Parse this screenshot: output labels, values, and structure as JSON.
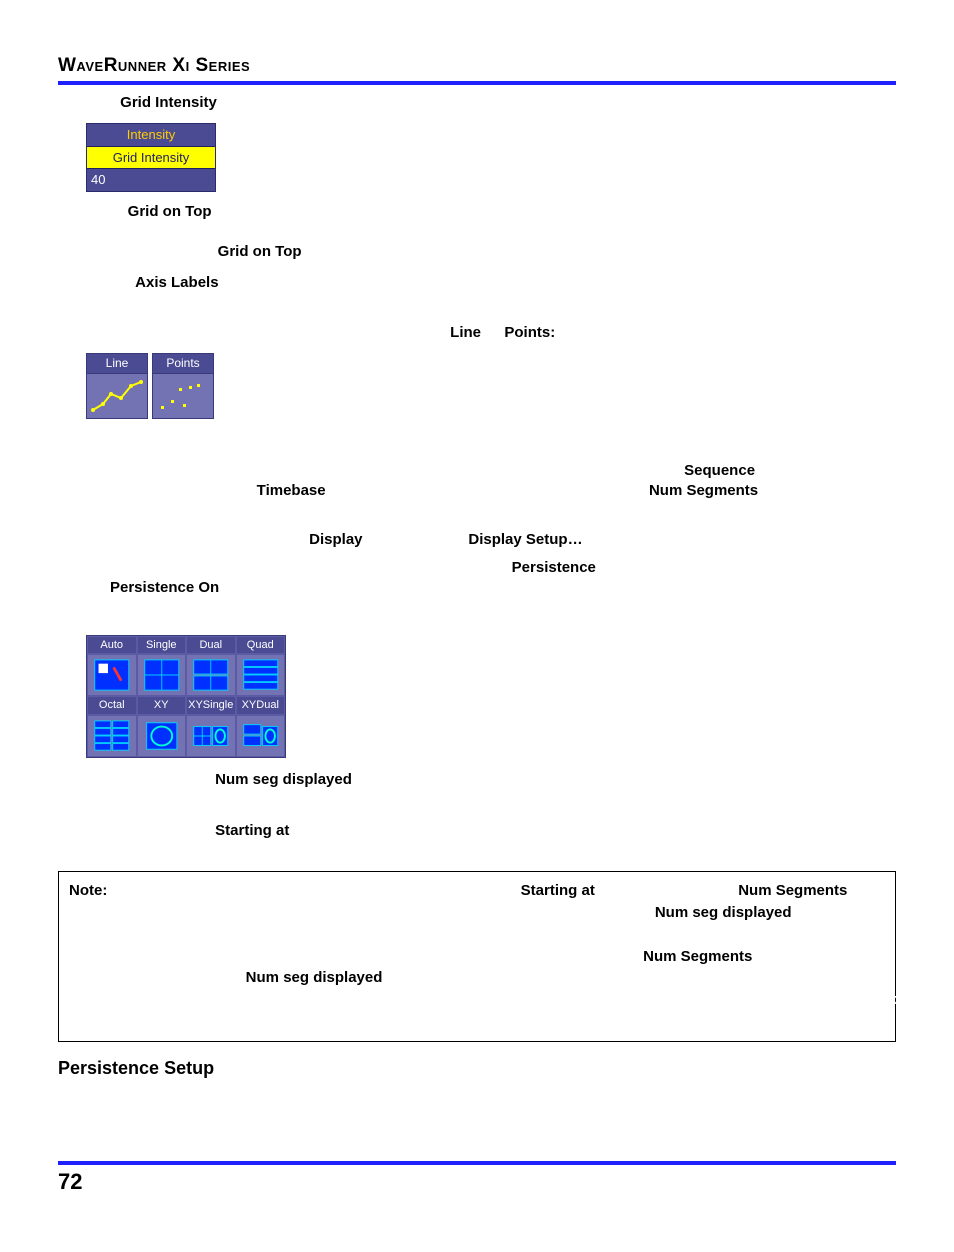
{
  "header": "WaveRunner Xi Series",
  "grid_intensity_label": "Grid Intensity",
  "intensity_widget": {
    "title": "Intensity",
    "label": "Grid Intensity",
    "value": "40"
  },
  "grid_on_top_label": "Grid on Top",
  "grid_on_top_inline": "Grid on Top",
  "axis_labels_label": "Axis Labels",
  "line_label": "Line",
  "points_label": "Points:",
  "lp_widget": {
    "line": "Line",
    "points": "Points"
  },
  "seq_mode": {
    "sequence": "Sequence",
    "timebase": "Timebase",
    "num_segments": "Num Segments",
    "display": "Display",
    "display_setup": "Display Setup…",
    "persistence": "Persistence",
    "persistence_on": "Persistence On"
  },
  "grid_widget": {
    "row1": [
      "Auto",
      "Single",
      "Dual",
      "Quad"
    ],
    "row2": [
      "Octal",
      "XY",
      "XYSingle",
      "XYDual"
    ]
  },
  "num_seg_displayed": "Num seg displayed",
  "starting_at": "Starting at",
  "note": {
    "note_label": "Note:",
    "starting_at": "Starting at",
    "num_segments": "Num Segments",
    "num_seg_displayed": "Num seg displayed",
    "num_segments2": "Num Segments",
    "num": "Num",
    "seg_displayed": "seg displayed"
  },
  "persistence_setup": "Persistence Setup",
  "page_number": "72"
}
